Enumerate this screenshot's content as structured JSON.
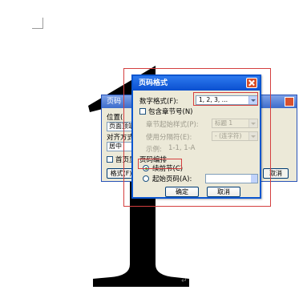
{
  "document": {
    "big_character": "1",
    "paragraph_mark": "↵"
  },
  "back_dialog": {
    "title": "页码",
    "position_label": "位置(",
    "position_value": "页面顶端",
    "alignment_label": "对齐方式(",
    "alignment_value": "居中",
    "first_page_label": "首页显",
    "format_button": "格式(F)",
    "cancel_button": "取消"
  },
  "format_dialog": {
    "title": "页码格式",
    "number_format_label": "数字格式(F):",
    "number_format_value": "1, 2, 3, …",
    "include_chapter_label": "包含章节号(N)",
    "chapter_style_label": "章节起始样式(P):",
    "chapter_style_value": "标题 1",
    "separator_label": "使用分隔符(E):",
    "separator_value": "- (连字符)",
    "example_label": "示例:",
    "example_value": "1-1, 1-A",
    "numbering_group": "页码编排",
    "continue_label": "续前节(C)",
    "start_at_label": "起始页码(A):",
    "start_at_value": "",
    "ok_button": "确定",
    "cancel_button": "取消"
  },
  "colors": {
    "annotation_red": "#d43f3f",
    "title_blue": "#0a4fd0"
  }
}
